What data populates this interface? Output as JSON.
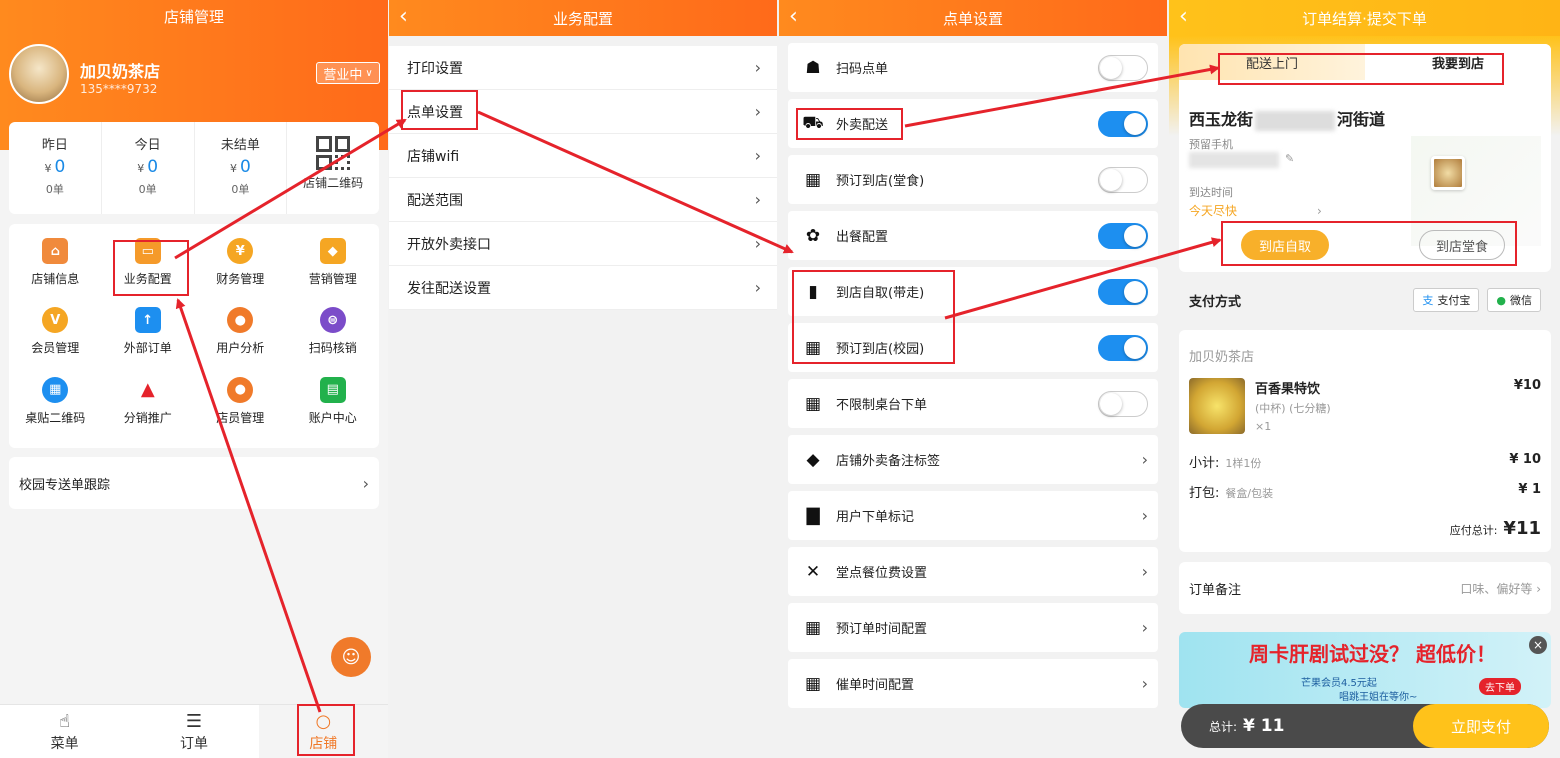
{
  "p1": {
    "title": "店铺管理",
    "store_name": "加贝奶茶店",
    "phone": "135****9732",
    "status": "营业中",
    "stats": [
      {
        "label": "昨日",
        "currency": "¥",
        "value": "0",
        "sub": "0单"
      },
      {
        "label": "今日",
        "currency": "¥",
        "value": "0",
        "sub": "0单"
      },
      {
        "label": "未结单",
        "currency": "¥",
        "value": "0",
        "sub": "0单"
      }
    ],
    "qr_label": "店铺二维码",
    "grid": [
      "店铺信息",
      "业务配置",
      "财务管理",
      "营销管理",
      "会员管理",
      "外部订单",
      "用户分析",
      "扫码核销",
      "桌贴二维码",
      "分销推广",
      "店员管理",
      "账户中心"
    ],
    "icon_glyphs": [
      "⌂",
      "▭",
      "¥",
      "◆",
      "V",
      "↑",
      "●",
      "⊜",
      "▦",
      "▲",
      "●",
      "▤"
    ],
    "track": "校园专送单跟踪",
    "tabs": [
      "菜单",
      "订单",
      "店铺"
    ]
  },
  "p2": {
    "title": "业务配置",
    "items": [
      "打印设置",
      "点单设置",
      "店铺wifi",
      "配送范围",
      "开放外卖接口",
      "发往配送设置"
    ]
  },
  "p3": {
    "title": "点单设置",
    "items": [
      {
        "label": "扫码点单",
        "toggle": false,
        "icon": "bell-icon"
      },
      {
        "label": "外卖配送",
        "toggle": true,
        "icon": "scooter-icon"
      },
      {
        "label": "预订到店(堂食)",
        "toggle": false,
        "icon": "calendar-icon"
      },
      {
        "label": "出餐配置",
        "toggle": true,
        "icon": "gear-icon"
      },
      {
        "label": "到店自取(带走)",
        "toggle": true,
        "icon": "store-icon"
      },
      {
        "label": "预订到店(校园)",
        "toggle": true,
        "icon": "calendar-icon"
      },
      {
        "label": "不限制桌台下单",
        "toggle": false,
        "icon": "calendar-icon"
      },
      {
        "label": "店铺外卖备注标签",
        "chevron": true,
        "icon": "tag-icon"
      },
      {
        "label": "用户下单标记",
        "chevron": true,
        "icon": "bookmark-icon"
      },
      {
        "label": "堂点餐位费设置",
        "chevron": true,
        "icon": "cutlery-icon"
      },
      {
        "label": "预订单时间配置",
        "chevron": true,
        "icon": "calendar-icon"
      },
      {
        "label": "催单时间配置",
        "chevron": true,
        "icon": "calendar-icon"
      }
    ]
  },
  "p4": {
    "title": "订单结算·提交下单",
    "seg": [
      "配送上门",
      "我要到店"
    ],
    "addr_pre": "西玉龙街",
    "addr_post": "河街道",
    "phone_label": "预留手机",
    "time_label": "到达时间",
    "time_value": "今天尽快",
    "pick": [
      "到店自取",
      "到店堂食"
    ],
    "pay_label": "支付方式",
    "pay_options": [
      "支付宝",
      "微信"
    ],
    "shop": "加贝奶茶店",
    "product": {
      "name": "百香果特饮",
      "spec": "(中杯) (七分糖)",
      "qty": "×1",
      "price": "¥10"
    },
    "subtotal": {
      "label": "小计:",
      "note": "1样1份",
      "value": "¥ 10"
    },
    "packing": {
      "label": "打包:",
      "note": "餐盒/包装",
      "value": "¥ 1"
    },
    "total_label": "应付总计:",
    "total_value": "¥11",
    "note_label": "订单备注",
    "note_hint": "口味、偏好等",
    "banner": {
      "headline": "周卡肝剧试过没？ 超低价！",
      "sub1": "芒果会员4.5元起",
      "sub2": "唱跳王姐在等你~",
      "cta": "去下单"
    },
    "bar_label": "总计:",
    "bar_total": "¥ 11",
    "bar_btn": "立即支付"
  },
  "colors": {
    "orange": "#ff7a1e",
    "blue": "#1d8ff0",
    "red": "#e5232b",
    "yellow": "#f8b02a"
  }
}
